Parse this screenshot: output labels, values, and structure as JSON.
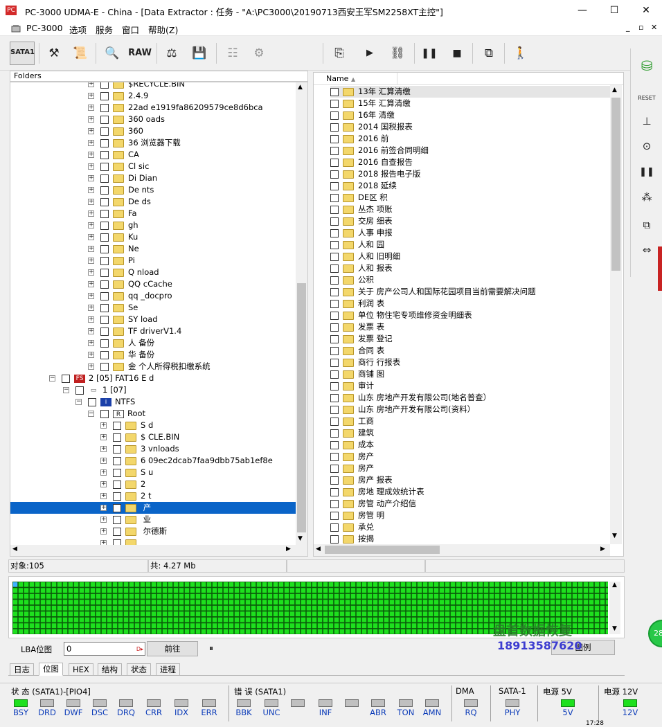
{
  "window": {
    "title": "PC-3000 UDMA-E - China - [Data Extractor : 任务 - \"A:\\PC3000\\20190713西安王军SM2258XT主控\"]",
    "app_icon": "PC",
    "min": "—",
    "max": "☐",
    "close": "✕"
  },
  "menu": [
    "PC-3000",
    "选项",
    "服务",
    "窗口",
    "帮助(Z)"
  ],
  "menu_right": [
    "_",
    "▫",
    "✕"
  ],
  "toolbar": {
    "sata_label": "SATA1",
    "raw_label": "RAW"
  },
  "folders_header": "Folders",
  "tree": {
    "top_items": [
      "$RECYCLE.BIN",
      "2.4.9",
      "22ad      e1919fa86209579ce8d6bca",
      "360         oads",
      "360",
      "36      浏览器下载",
      "CA",
      "Cl            sic",
      "Di          Dian",
      "De         nts",
      "De         ds",
      "Fa",
      "gh",
      "Ku",
      "Ne",
      "Pi",
      "Q          nload",
      "QQ        cCache",
      "qq         _docpro",
      "Se",
      "SY         load",
      "TF          driverV1.4",
      "人         备份",
      "华         备份",
      "金         个人所得税扣缴系统"
    ],
    "partition": "2 [05] FAT16 E        d",
    "sub": "1 [07]",
    "ntfs": "NTFS",
    "root": "Root",
    "root_items": [
      "S          d",
      "$          CLE.BIN",
      "3          vnloads",
      "6          09ec2dcab7faa9dbb75ab1ef8e",
      "S          u",
      "2",
      "2          t",
      "            产",
      "            业",
      "            尔德斯",
      ""
    ]
  },
  "list": {
    "column_name": "Name",
    "items": [
      "13年        汇算清缴",
      "15年        汇算清缴",
      "16年        清缴",
      "2014        国税报表",
      "2016        前",
      "2016        前签合同明细",
      "2016        自查报告",
      "2018        报告电子版",
      "2018        延续",
      "DE区        积",
      "丛杰        项账",
      "交房        细表",
      "人事        申报",
      "人和        园",
      "人和        旧明细",
      "人和        报表",
      "公积",
      "关于        房产公司人和国际花园项目当前需要解决问题",
      "利润        表",
      "单位        物住宅专项维修资金明细表",
      "发票        表",
      "发票        登记",
      "合同        表",
      "商行        行报表",
      "商铺        图",
      "审计",
      "山东        房地产开发有限公司(地名普查）",
      "山东        房地产开发有限公司(资料）",
      "工商",
      "建筑",
      "成本",
      "房产",
      "房产",
      "房产        报表",
      "房地        理成效统计表",
      "房管        动产介绍信",
      "房管        明",
      "承兑",
      "按揭"
    ]
  },
  "status": {
    "objects": "对象:105",
    "total": "共:  4.27 Mb"
  },
  "lba": {
    "label": "LBA位图",
    "value": "0",
    "goto_button": "前往",
    "pause_icon": "⏸",
    "right_button": "图例"
  },
  "bottom_tabs": [
    "日志",
    "位图",
    "HEX",
    "结构",
    "状态",
    "进程"
  ],
  "active_tab": "位图",
  "indicators": {
    "status_group": "状 态 (SATA1)-[PIO4]",
    "status_leds": [
      "BSY",
      "DRD",
      "DWF",
      "DSC",
      "DRQ",
      "CRR",
      "IDX",
      "ERR"
    ],
    "error_group": "错 误 (SATA1)",
    "error_leds": [
      "BBK",
      "UNC",
      "",
      "INF",
      "",
      "ABR",
      "TON",
      "AMN"
    ],
    "dma_group": "DMA",
    "dma_led": "RQ",
    "sata_group": "SATA-1",
    "sata_led": "PHY",
    "power5_group": "电源 5V",
    "power5_led": "5V",
    "power12_group": "电源 12V",
    "power12_led": "12V",
    "clock": "17:28"
  },
  "watermark": {
    "line1": "盘首数据恢复",
    "line2": "18913587620"
  },
  "side_badge": "28",
  "side_toolbar_reset": "RESET",
  "colors": {
    "selection": "#0a64c8",
    "map_green": "#1ee01e",
    "led_label": "#0b3bb8"
  }
}
